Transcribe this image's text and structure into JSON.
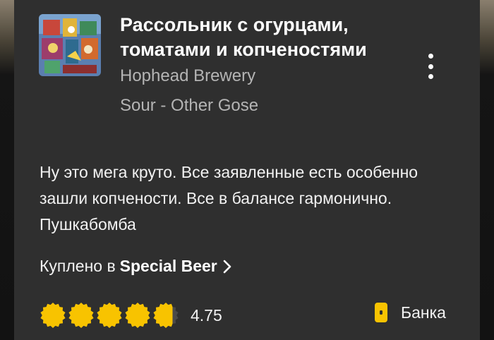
{
  "beer": {
    "name": "Рассольник с огурцами, томатами и копченостями",
    "brewery": "Hophead Brewery",
    "style": "Sour - Other Gose"
  },
  "review": {
    "text": "Ну это мега круто. Все заявленные есть особенно зашли копчености. Все в балансе гармонично. Пушкабомба"
  },
  "purchase": {
    "prefix": "Куплено в",
    "venue": "Special Beer"
  },
  "rating": {
    "score": "4.75",
    "value": 4.75,
    "max": 5
  },
  "serving": {
    "label": "Банка",
    "icon": "can-icon"
  },
  "colors": {
    "card_bg": "#2f2f2f",
    "accent": "#f8c300",
    "muted_text": "#b4b4b4"
  },
  "icons": {
    "menu": "more-vertical-icon",
    "chevron": "chevron-right-icon",
    "rating": "bottle-cap-icon"
  }
}
